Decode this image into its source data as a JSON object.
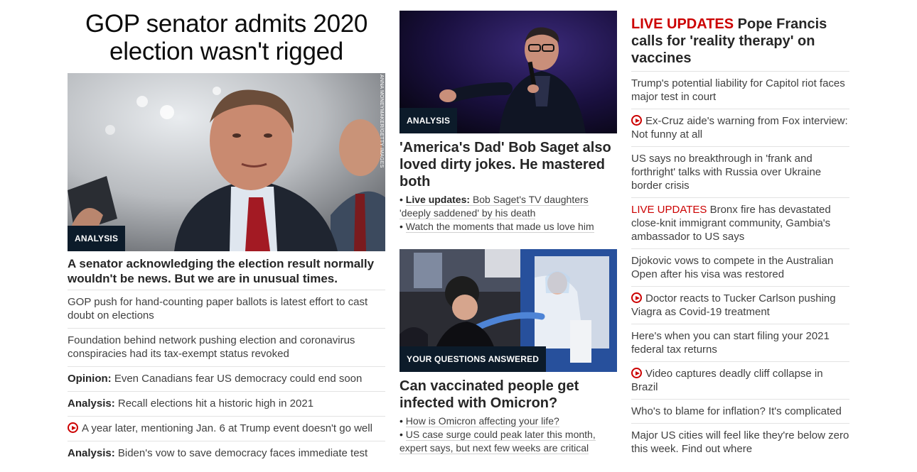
{
  "col1": {
    "headline": "GOP senator admits 2020 election wasn't rigged",
    "image": {
      "label": "ANALYSIS",
      "credit": "ANNA MONEYMAKER/GETTY IMAGES"
    },
    "description": "A senator acknowledging the election result normally wouldn't be news. But we are in unusual times.",
    "links": [
      {
        "tag": "",
        "text": "GOP push for hand-counting paper ballots is latest effort to cast doubt on elections"
      },
      {
        "tag": "",
        "text": "Foundation behind network pushing election and coronavirus conspiracies had its tax-exempt status revoked"
      },
      {
        "tag": "Opinion:",
        "text": "Even Canadians fear US democracy could end soon"
      },
      {
        "tag": "Analysis:",
        "text": "Recall elections hit a historic high in 2021"
      },
      {
        "tag": "",
        "video": true,
        "text": "A year later, mentioning Jan. 6 at Trump event doesn't go well"
      },
      {
        "tag": "Analysis:",
        "text": "Biden's vow to save democracy faces immediate test"
      }
    ]
  },
  "col2": {
    "card1": {
      "label": "ANALYSIS",
      "title": "'America's Dad' Bob Saget also loved dirty jokes. He mastered both",
      "bullets": [
        {
          "tag": "Live updates:",
          "text": "Bob Saget's TV daughters 'deeply saddened' by his death"
        },
        {
          "tag": "",
          "text": "Watch the moments that made us love him"
        }
      ]
    },
    "card2": {
      "label": "YOUR QUESTIONS ANSWERED",
      "title": "Can vaccinated people get infected with Omicron?",
      "bullets": [
        {
          "tag": "",
          "text": "How is Omicron affecting your life?"
        },
        {
          "tag": "",
          "text": "US case surge could peak later this month, expert says, but next few weeks are critical"
        }
      ]
    }
  },
  "col3": {
    "top": {
      "live": "LIVE UPDATES",
      "title": "Pope Francis calls for 'reality therapy' on vaccines"
    },
    "links": [
      {
        "text": "Trump's potential liability for Capitol riot faces major test in court"
      },
      {
        "video": true,
        "text": "Ex-Cruz aide's warning from Fox interview: Not funny at all"
      },
      {
        "text": "US says no breakthrough in 'frank and forthright' talks with Russia over Ukraine border crisis"
      },
      {
        "live": "LIVE UPDATES",
        "text": "Bronx fire has devastated close-knit immigrant community, Gambia's ambassador to US says"
      },
      {
        "text": "Djokovic vows to compete in the Australian Open after his visa was restored"
      },
      {
        "video": true,
        "text": "Doctor reacts to Tucker Carlson pushing Viagra as Covid-19 treatment"
      },
      {
        "text": "Here's when you can start filing your 2021 federal tax returns"
      },
      {
        "video": true,
        "text": "Video captures deadly cliff collapse in Brazil"
      },
      {
        "text": "Who's to blame for inflation? It's complicated"
      },
      {
        "text": "Major US cities will feel like they're below zero this week. Find out where"
      }
    ]
  },
  "colors": {
    "accent_red": "#cc0000",
    "label_bg": "#0c1b2a",
    "divider": "#e3e3e3"
  },
  "icons": {
    "video": "play-circle-icon"
  }
}
